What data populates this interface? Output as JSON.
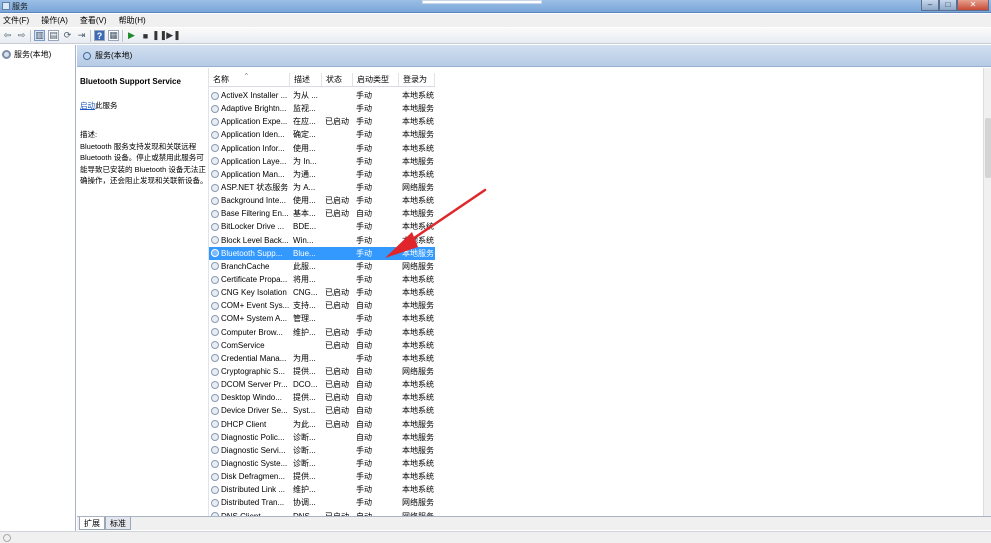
{
  "window": {
    "title": "服务"
  },
  "menu": [
    "文件(F)",
    "操作(A)",
    "查看(V)",
    "帮助(H)"
  ],
  "tree": {
    "root": "服务(本地)"
  },
  "content": {
    "header": "服务(本地)"
  },
  "description": {
    "service_name": "Bluetooth Support Service",
    "start_link": "启动",
    "start_suffix": "此服务",
    "desc_label": "描述:",
    "desc_text": "Bluetooth 服务支持发现和关联远程 Bluetooth 设备。停止或禁用此服务可能导致已安装的 Bluetooth 设备无法正确操作，还会阻止发现和关联新设备。"
  },
  "columns": {
    "name": "名称",
    "desc": "描述",
    "status": "状态",
    "type": "启动类型",
    "logon": "登录为"
  },
  "rows": [
    {
      "name": "ActiveX Installer ...",
      "desc": "为从 ...",
      "status": "",
      "type": "手动",
      "logon": "本地系统"
    },
    {
      "name": "Adaptive Brightn...",
      "desc": "监视...",
      "status": "",
      "type": "手动",
      "logon": "本地服务"
    },
    {
      "name": "Application Expe...",
      "desc": "在应...",
      "status": "已启动",
      "type": "手动",
      "logon": "本地系统"
    },
    {
      "name": "Application Iden...",
      "desc": "确定...",
      "status": "",
      "type": "手动",
      "logon": "本地服务"
    },
    {
      "name": "Application Infor...",
      "desc": "使用...",
      "status": "",
      "type": "手动",
      "logon": "本地系统"
    },
    {
      "name": "Application Laye...",
      "desc": "为 In...",
      "status": "",
      "type": "手动",
      "logon": "本地服务"
    },
    {
      "name": "Application Man...",
      "desc": "为通...",
      "status": "",
      "type": "手动",
      "logon": "本地系统"
    },
    {
      "name": "ASP.NET 状态服务",
      "desc": "为 A...",
      "status": "",
      "type": "手动",
      "logon": "网络服务"
    },
    {
      "name": "Background Inte...",
      "desc": "使用...",
      "status": "已启动",
      "type": "手动",
      "logon": "本地系统"
    },
    {
      "name": "Base Filtering En...",
      "desc": "基本...",
      "status": "已启动",
      "type": "自动",
      "logon": "本地服务"
    },
    {
      "name": "BitLocker Drive ...",
      "desc": "BDE...",
      "status": "",
      "type": "手动",
      "logon": "本地系统"
    },
    {
      "name": "Block Level Back...",
      "desc": "Win...",
      "status": "",
      "type": "手动",
      "logon": "本地系统"
    },
    {
      "name": "Bluetooth Supp...",
      "desc": "Blue...",
      "status": "",
      "type": "手动",
      "logon": "本地服务",
      "selected": true
    },
    {
      "name": "BranchCache",
      "desc": "此服...",
      "status": "",
      "type": "手动",
      "logon": "网络服务"
    },
    {
      "name": "Certificate Propa...",
      "desc": "将用...",
      "status": "",
      "type": "手动",
      "logon": "本地系统"
    },
    {
      "name": "CNG Key Isolation",
      "desc": "CNG...",
      "status": "已启动",
      "type": "手动",
      "logon": "本地系统"
    },
    {
      "name": "COM+ Event Sys...",
      "desc": "支持...",
      "status": "已启动",
      "type": "自动",
      "logon": "本地服务"
    },
    {
      "name": "COM+ System A...",
      "desc": "管理...",
      "status": "",
      "type": "手动",
      "logon": "本地系统"
    },
    {
      "name": "Computer Brow...",
      "desc": "维护...",
      "status": "已启动",
      "type": "手动",
      "logon": "本地系统"
    },
    {
      "name": "ComService",
      "desc": "",
      "status": "已启动",
      "type": "自动",
      "logon": "本地系统"
    },
    {
      "name": "Credential Mana...",
      "desc": "为用...",
      "status": "",
      "type": "手动",
      "logon": "本地系统"
    },
    {
      "name": "Cryptographic S...",
      "desc": "提供...",
      "status": "已启动",
      "type": "自动",
      "logon": "网络服务"
    },
    {
      "name": "DCOM Server Pr...",
      "desc": "DCO...",
      "status": "已启动",
      "type": "自动",
      "logon": "本地系统"
    },
    {
      "name": "Desktop Windo...",
      "desc": "提供...",
      "status": "已启动",
      "type": "自动",
      "logon": "本地系统"
    },
    {
      "name": "Device Driver Se...",
      "desc": "Syst...",
      "status": "已启动",
      "type": "自动",
      "logon": "本地系统"
    },
    {
      "name": "DHCP Client",
      "desc": "为此...",
      "status": "已启动",
      "type": "自动",
      "logon": "本地服务"
    },
    {
      "name": "Diagnostic Polic...",
      "desc": "诊断...",
      "status": "",
      "type": "自动",
      "logon": "本地服务"
    },
    {
      "name": "Diagnostic Servi...",
      "desc": "诊断...",
      "status": "",
      "type": "手动",
      "logon": "本地服务"
    },
    {
      "name": "Diagnostic Syste...",
      "desc": "诊断...",
      "status": "",
      "type": "手动",
      "logon": "本地系统"
    },
    {
      "name": "Disk Defragmen...",
      "desc": "提供...",
      "status": "",
      "type": "手动",
      "logon": "本地系统"
    },
    {
      "name": "Distributed Link ...",
      "desc": "维护...",
      "status": "",
      "type": "手动",
      "logon": "本地系统"
    },
    {
      "name": "Distributed Tran...",
      "desc": "协调...",
      "status": "",
      "type": "手动",
      "logon": "网络服务"
    },
    {
      "name": "DNS Client",
      "desc": "DNS...",
      "status": "已启动",
      "type": "自动",
      "logon": "网络服务"
    }
  ],
  "tabs": [
    "扩展",
    "标准"
  ],
  "colors": {
    "selection": "#3399ff",
    "arrow": "#e0262a",
    "header": "#c4d6ee"
  }
}
